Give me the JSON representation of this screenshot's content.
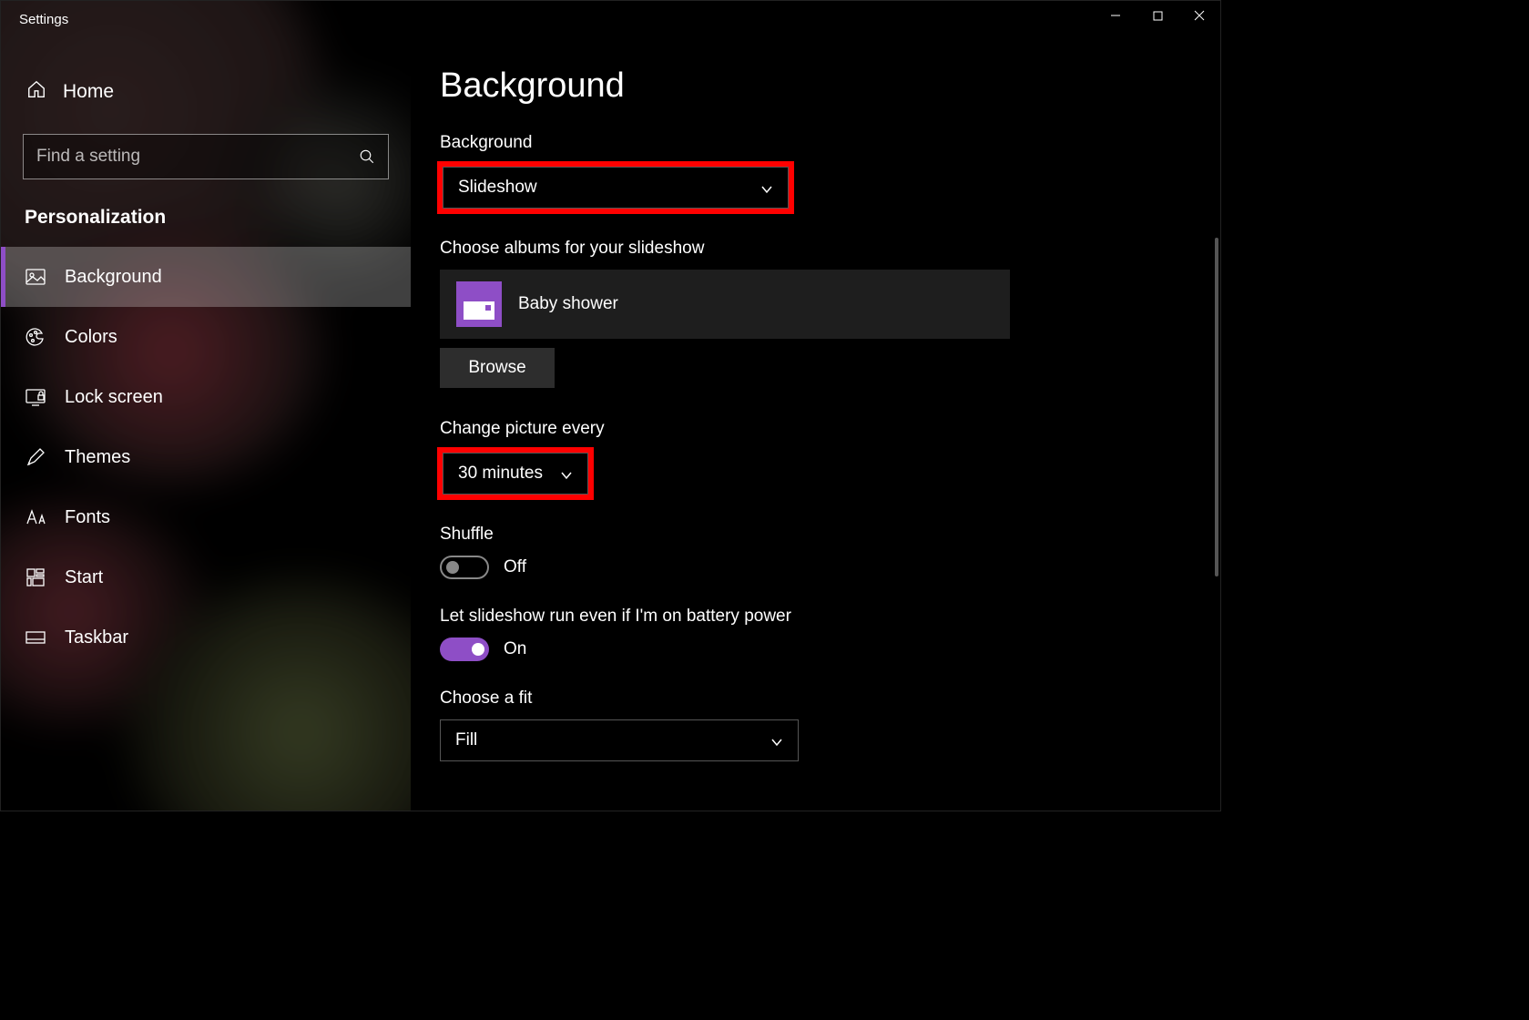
{
  "window": {
    "title": "Settings"
  },
  "sidebar": {
    "home": "Home",
    "search_placeholder": "Find a setting",
    "section": "Personalization",
    "items": [
      {
        "label": "Background",
        "icon": "picture",
        "active": true
      },
      {
        "label": "Colors",
        "icon": "palette",
        "active": false
      },
      {
        "label": "Lock screen",
        "icon": "lock-monitor",
        "active": false
      },
      {
        "label": "Themes",
        "icon": "brush",
        "active": false
      },
      {
        "label": "Fonts",
        "icon": "font",
        "active": false
      },
      {
        "label": "Start",
        "icon": "tiles",
        "active": false
      },
      {
        "label": "Taskbar",
        "icon": "taskbar",
        "active": false
      }
    ]
  },
  "main": {
    "title": "Background",
    "background_label": "Background",
    "background_value": "Slideshow",
    "albums_label": "Choose albums for your slideshow",
    "album_name": "Baby shower",
    "browse": "Browse",
    "interval_label": "Change picture every",
    "interval_value": "30 minutes",
    "shuffle_label": "Shuffle",
    "shuffle_state": "Off",
    "battery_label": "Let slideshow run even if I'm on battery power",
    "battery_state": "On",
    "fit_label": "Choose a fit",
    "fit_value": "Fill"
  },
  "colors": {
    "accent": "#8e4ec6",
    "highlight": "#ff0000"
  }
}
